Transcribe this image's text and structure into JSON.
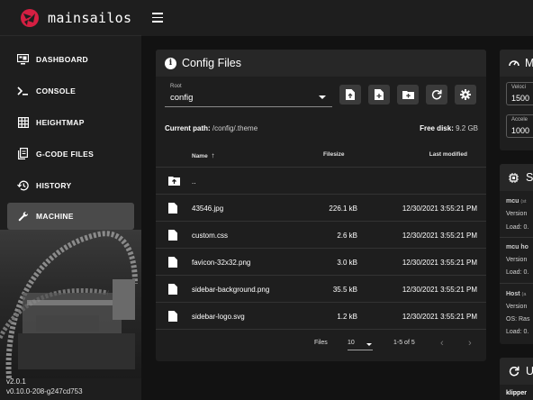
{
  "app": {
    "name": "mainsailos",
    "version": "v2.0.1",
    "build": "v0.10.0-208-g247cd753"
  },
  "nav": [
    {
      "label": "DASHBOARD",
      "icon": "monitor-dashboard-icon"
    },
    {
      "label": "CONSOLE",
      "icon": "console-icon"
    },
    {
      "label": "HEIGHTMAP",
      "icon": "grid-icon"
    },
    {
      "label": "G-CODE FILES",
      "icon": "file-document-icon"
    },
    {
      "label": "HISTORY",
      "icon": "history-icon"
    },
    {
      "label": "MACHINE",
      "icon": "wrench-icon",
      "active": true
    }
  ],
  "config": {
    "title": "Config Files",
    "root_label": "Root",
    "root_value": "config",
    "current_path_label": "Current path:",
    "current_path": "/config/.theme",
    "free_disk_label": "Free disk:",
    "free_disk": "9.2 GB",
    "columns": {
      "name": "Name",
      "filesize": "Filesize",
      "modified": "Last modified"
    },
    "parent_dir": "..",
    "files": [
      {
        "name": "43546.jpg",
        "size": "226.1 kB",
        "modified": "12/30/2021 3:55:21 PM"
      },
      {
        "name": "custom.css",
        "size": "2.6 kB",
        "modified": "12/30/2021 3:55:21 PM"
      },
      {
        "name": "favicon-32x32.png",
        "size": "3.0 kB",
        "modified": "12/30/2021 3:55:21 PM"
      },
      {
        "name": "sidebar-background.png",
        "size": "35.5 kB",
        "modified": "12/30/2021 3:55:21 PM"
      },
      {
        "name": "sidebar-logo.svg",
        "size": "1.2 kB",
        "modified": "12/30/2021 3:55:21 PM"
      }
    ],
    "footer": {
      "files_label": "Files",
      "per_page": "10",
      "range": "1-5 of 5"
    }
  },
  "right_cards": {
    "machine": {
      "title": "M",
      "velocity_label": "Veloci",
      "velocity_value": "1500",
      "accel_label": "Accele",
      "accel_value": "1000"
    },
    "system": {
      "title": "S",
      "mcu_name": "mcu",
      "mcu_tag": "(st",
      "mcu_version": "Version",
      "mcu_load": "Load: 0.",
      "host_mcu_name": "mcu ho",
      "host_mcu_version": "Version",
      "host_mcu_load": "Load: 0.",
      "host_name": "Host",
      "host_tag": "(a",
      "host_version": "Version",
      "host_os": "OS: Ras",
      "host_load": "Load: 0."
    },
    "updates": {
      "title": "U",
      "first_item": "klipper"
    }
  },
  "colors": {
    "accent": "#d51f42",
    "bg": "#121212",
    "card": "#1e1e1e"
  }
}
